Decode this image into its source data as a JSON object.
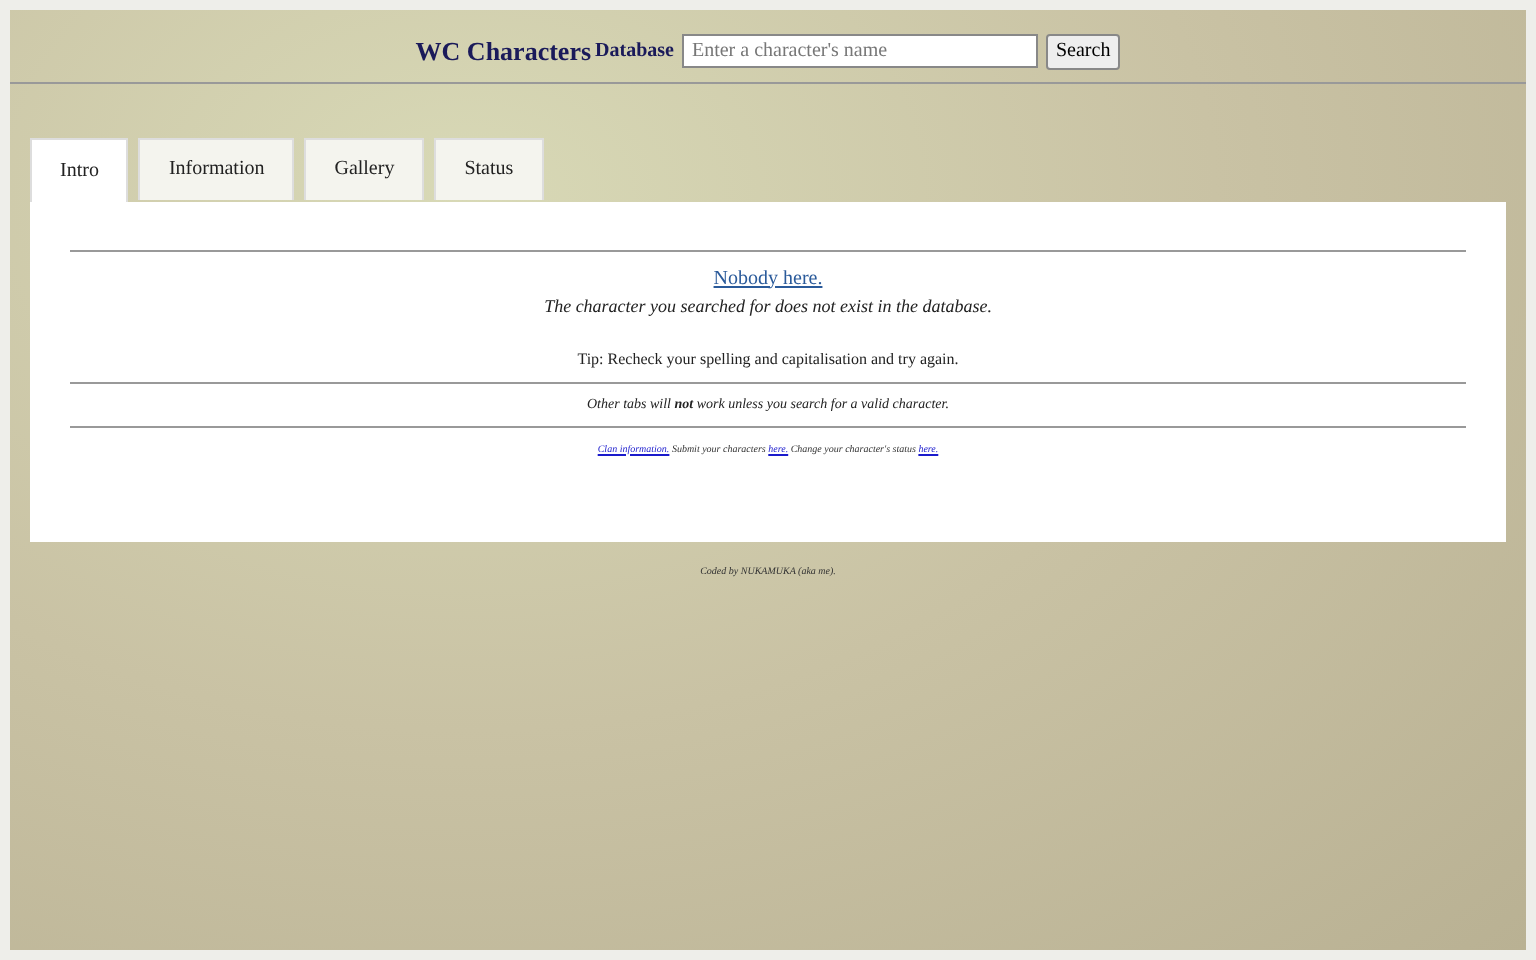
{
  "header": {
    "title": "WC Characters",
    "subtitle": "Database",
    "search": {
      "placeholder": "Enter a character's name"
    },
    "button": "Search"
  },
  "tabs": [
    {
      "label": "Intro",
      "selected": true
    },
    {
      "label": "Information",
      "selected": false
    },
    {
      "label": "Gallery",
      "selected": false
    },
    {
      "label": "Status",
      "selected": false
    }
  ],
  "panel": {
    "heading_link": "Nobody here.",
    "message": "The character you searched for does not exist in the database.",
    "tip": "Tip: Recheck your spelling and capitalisation and try again.",
    "note": "Other tabs will **not** work unless you search for a valid character.",
    "links_line": [
      {
        "kind": "link",
        "text": "Clan information."
      },
      {
        "kind": "text",
        "text": " Submit your characters "
      },
      {
        "kind": "link",
        "text": "here."
      },
      {
        "kind": "text",
        "text": " Change your character's status "
      },
      {
        "kind": "link",
        "text": "here."
      }
    ]
  },
  "footer": "Coded by NUKAMUKA (aka me)."
}
